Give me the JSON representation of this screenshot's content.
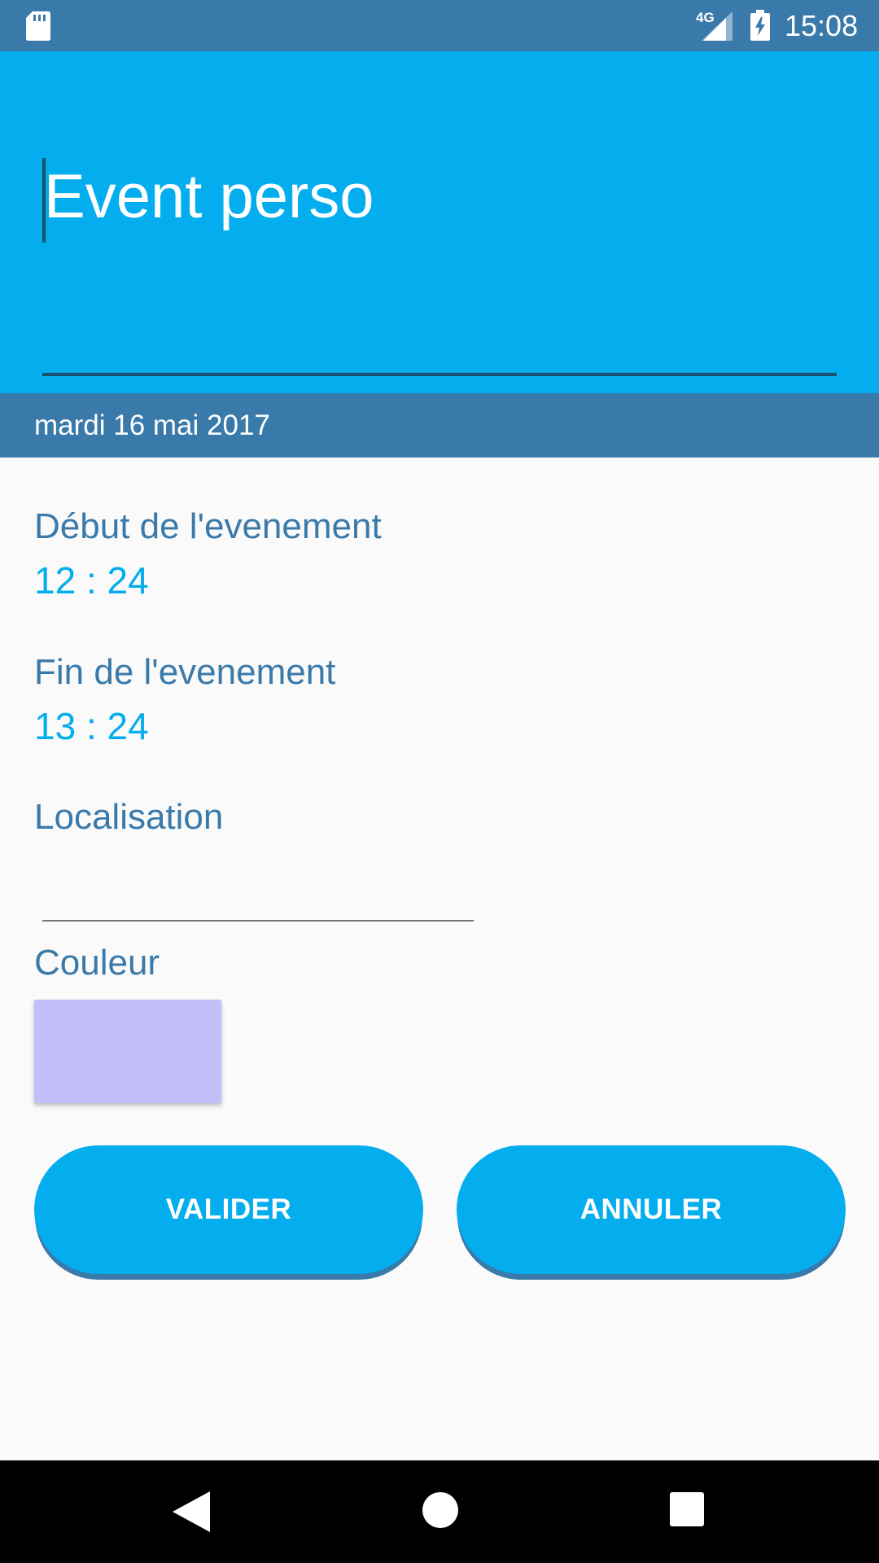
{
  "status_bar": {
    "network": "4G",
    "time": "15:08",
    "icons": [
      "sd-card-icon",
      "signal-icon",
      "battery-charging-icon"
    ]
  },
  "title": {
    "value": "Event perso"
  },
  "date_bar": {
    "date": "mardi 16 mai 2017"
  },
  "form": {
    "start_label": "Début de l'evenement",
    "start_time": "12 : 24",
    "end_label": "Fin de l'evenement",
    "end_time": "13 : 24",
    "location_label": "Localisation",
    "location_value": "",
    "color_label": "Couleur",
    "color_value": "#C2BFFB"
  },
  "buttons": {
    "validate": "VALIDER",
    "cancel": "ANNULER"
  },
  "nav_bar": {
    "icons": [
      "back-icon",
      "home-icon",
      "recents-icon"
    ]
  },
  "colors": {
    "primary": "#03ADEE",
    "primary_dark": "#3A7AAA",
    "background": "#FAFAFA"
  }
}
